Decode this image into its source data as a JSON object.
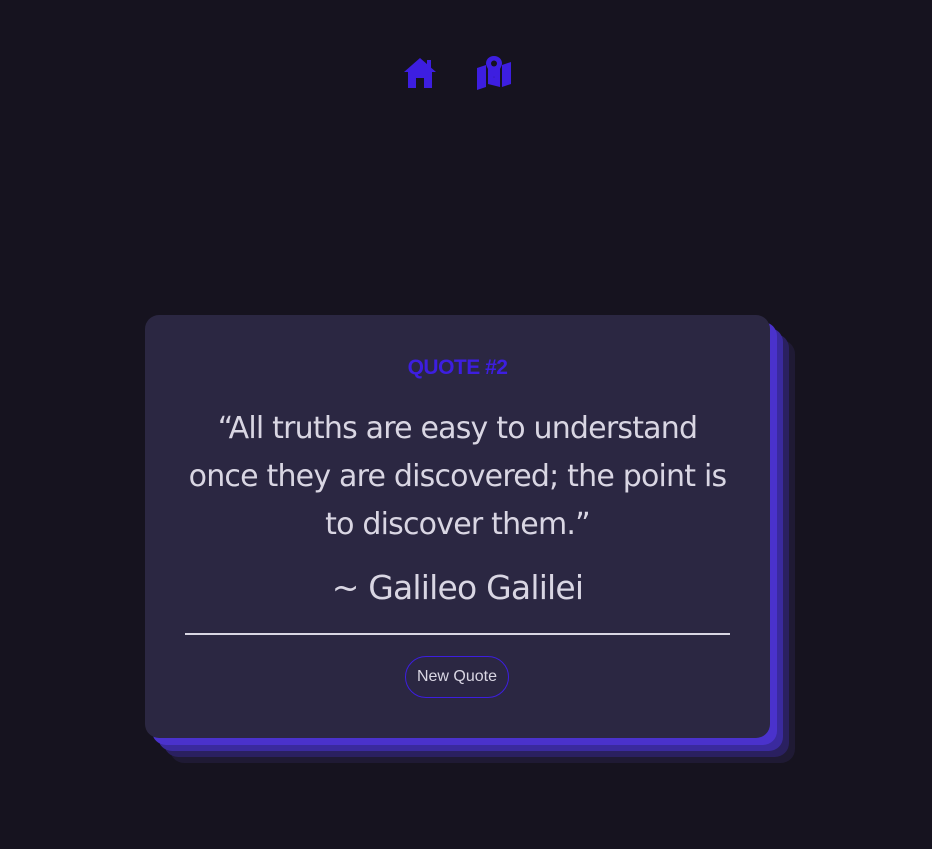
{
  "nav": {
    "icons": [
      "home-icon",
      "map-location-icon"
    ],
    "accent_color": "#3d1ee0"
  },
  "card": {
    "quote_number": "QUOTE #2",
    "quote_text": "“All truths are easy to understand once they are discovered; the point is to discover them.”",
    "author": "~ Galileo Galilei",
    "button_label": "New Quote"
  },
  "colors": {
    "background": "#16131f",
    "card_background": "#2b2742",
    "accent": "#3d1ee0",
    "text": "#d9d6e3"
  }
}
